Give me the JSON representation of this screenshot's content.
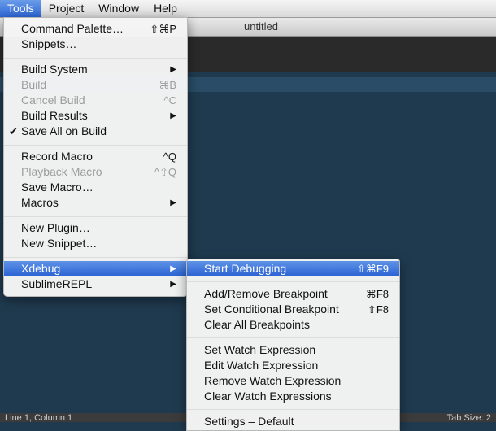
{
  "menubar": {
    "items": [
      "Tools",
      "Project",
      "Window",
      "Help"
    ]
  },
  "window": {
    "title": "untitled"
  },
  "statusbar": {
    "left": "Line 1, Column 1",
    "right": "Tab Size: 2"
  },
  "tools_menu": {
    "items": [
      {
        "label": "Command Palette…",
        "shortcut": "⇧⌘P"
      },
      {
        "label": "Snippets…"
      },
      {
        "label": "Build System",
        "submenu": true
      },
      {
        "label": "Build",
        "shortcut": "⌘B",
        "disabled": true
      },
      {
        "label": "Cancel Build",
        "shortcut": "^C",
        "disabled": true
      },
      {
        "label": "Build Results",
        "submenu": true
      },
      {
        "label": "Save All on Build",
        "checked": true
      },
      {
        "label": "Record Macro",
        "shortcut": "^Q"
      },
      {
        "label": "Playback Macro",
        "shortcut": "^⇧Q",
        "disabled": true
      },
      {
        "label": "Save Macro…"
      },
      {
        "label": "Macros",
        "submenu": true
      },
      {
        "label": "New Plugin…"
      },
      {
        "label": "New Snippet…"
      },
      {
        "label": "Xdebug",
        "submenu": true,
        "highlighted": true
      },
      {
        "label": "SublimeREPL",
        "submenu": true
      }
    ]
  },
  "xdebug_menu": {
    "items": [
      {
        "label": "Start Debugging",
        "shortcut": "⇧⌘F9",
        "highlighted": true
      },
      {
        "label": "Add/Remove Breakpoint",
        "shortcut": "⌘F8"
      },
      {
        "label": "Set Conditional Breakpoint",
        "shortcut": "⇧F8"
      },
      {
        "label": "Clear All Breakpoints"
      },
      {
        "label": "Set Watch Expression"
      },
      {
        "label": "Edit Watch Expression"
      },
      {
        "label": "Remove Watch Expression"
      },
      {
        "label": "Clear Watch Expressions"
      },
      {
        "label": "Settings – Default"
      }
    ]
  },
  "glyphs": {
    "submenu_arrow": "▶",
    "check": "✔"
  }
}
